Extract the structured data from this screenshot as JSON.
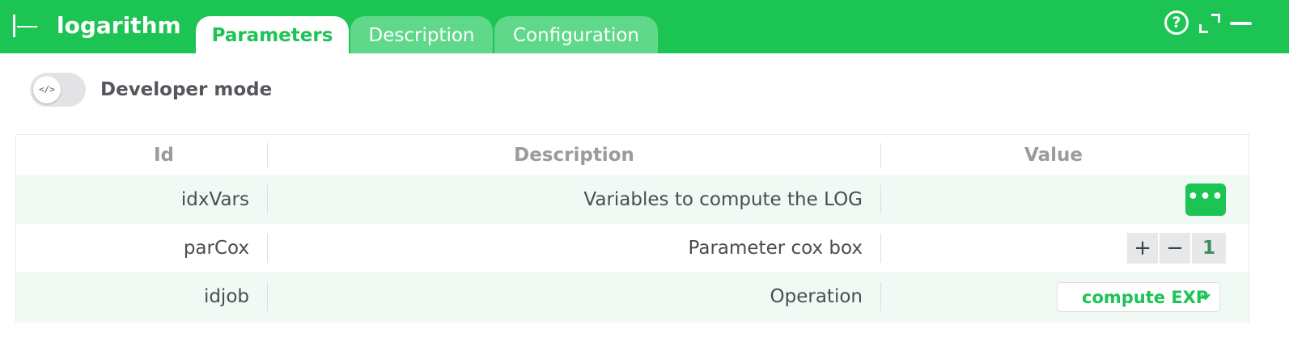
{
  "header": {
    "title": "logarithm",
    "tabs": [
      "Parameters",
      "Description",
      "Configuration"
    ],
    "active_tab": "Parameters",
    "help_glyph": "?"
  },
  "developer_mode": {
    "label": "Developer mode",
    "knob_glyph": "</>",
    "enabled": false
  },
  "table": {
    "columns": [
      "Id",
      "Description",
      "Value"
    ],
    "rows": [
      {
        "id": "idxVars",
        "description": "Variables to compute the LOG",
        "value_type": "button",
        "value": "•••"
      },
      {
        "id": "parCox",
        "description": "Parameter cox box",
        "value_type": "stepper",
        "value": "1",
        "plus": "+",
        "minus": "−"
      },
      {
        "id": "idjob",
        "description": "Operation",
        "value_type": "select",
        "value": "compute EXP"
      }
    ]
  },
  "colors": {
    "accent": "#1bc453",
    "tab_inactive": "#5fd88a",
    "row_alt": "#f1f9f4"
  },
  "icons": [
    "node-icon",
    "help-icon",
    "expand-icon",
    "minimize-icon",
    "code-icon",
    "ellipsis-icon",
    "chevron-down-icon"
  ]
}
